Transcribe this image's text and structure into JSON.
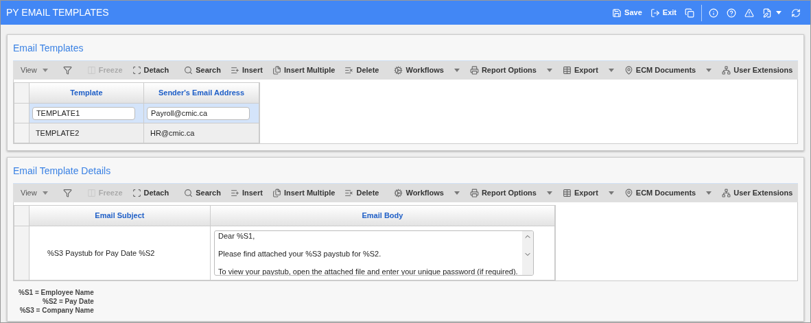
{
  "header": {
    "title": "PY EMAIL TEMPLATES",
    "actions": [
      {
        "kind": "save",
        "label": "Save"
      },
      {
        "kind": "exit",
        "label": "Exit"
      },
      {
        "kind": "copy"
      },
      {
        "kind": "info",
        "separator": true
      },
      {
        "kind": "help"
      },
      {
        "kind": "warning"
      },
      {
        "kind": "edit",
        "menu": true
      },
      {
        "kind": "refresh"
      }
    ]
  },
  "panels": [
    {
      "title": "Email Templates",
      "toolbar": [
        {
          "kind": "view",
          "label": "View",
          "menu": true,
          "disabled": false
        },
        {
          "kind": "filter",
          "disabled": false
        },
        {
          "kind": "freeze",
          "label": "Freeze",
          "disabled": true
        },
        {
          "kind": "detach",
          "label": "Detach",
          "disabled": false
        },
        {
          "kind": "search",
          "label": "Search",
          "disabled": false
        },
        {
          "kind": "insert",
          "label": "Insert",
          "disabled": false
        },
        {
          "kind": "insert-multiple",
          "label": "Insert Multiple",
          "disabled": false
        },
        {
          "kind": "delete",
          "label": "Delete",
          "disabled": false
        },
        {
          "kind": "workflows",
          "label": "Workflows",
          "menu": true,
          "disabled": false
        },
        {
          "kind": "report",
          "label": "Report Options",
          "menu": true,
          "disabled": false
        },
        {
          "kind": "export",
          "label": "Export",
          "menu": true,
          "disabled": false
        },
        {
          "kind": "ecm",
          "label": "ECM Documents",
          "menu": true,
          "disabled": false
        },
        {
          "kind": "extensions",
          "label": "User Extensions",
          "disabled": false
        }
      ],
      "table": {
        "kind": "simple",
        "columns": [
          "Template",
          "Sender's Email Address"
        ],
        "rows": [
          {
            "selected": true,
            "cells": [
              "TEMPLATE1",
              "Payroll@cmic.ca"
            ]
          },
          {
            "selected": false,
            "cells": [
              "TEMPLATE2",
              "HR@cmic.ca"
            ]
          }
        ]
      }
    },
    {
      "title": "Email Template Details",
      "toolbar": [
        {
          "kind": "view",
          "label": "View",
          "menu": true,
          "disabled": false
        },
        {
          "kind": "filter",
          "disabled": false
        },
        {
          "kind": "freeze",
          "label": "Freeze",
          "disabled": true
        },
        {
          "kind": "detach",
          "label": "Detach",
          "disabled": false
        },
        {
          "kind": "search",
          "label": "Search",
          "disabled": false
        },
        {
          "kind": "insert",
          "label": "Insert",
          "disabled": false
        },
        {
          "kind": "insert-multiple",
          "label": "Insert Multiple",
          "disabled": false
        },
        {
          "kind": "delete",
          "label": "Delete",
          "disabled": false
        },
        {
          "kind": "workflows",
          "label": "Workflows",
          "menu": true,
          "disabled": false
        },
        {
          "kind": "report",
          "label": "Report Options",
          "menu": true,
          "disabled": false
        },
        {
          "kind": "export",
          "label": "Export",
          "menu": true,
          "disabled": false
        },
        {
          "kind": "ecm",
          "label": "ECM Documents",
          "menu": true,
          "disabled": false
        },
        {
          "kind": "extensions",
          "label": "User Extensions",
          "disabled": false
        }
      ],
      "table": {
        "kind": "body",
        "columns": [
          "Email Subject",
          "Email Body"
        ],
        "rows": [
          {
            "selected": false,
            "cells": [
              "%S3 Paystub for Pay Date %S2"
            ],
            "body": [
              "Dear %S1,",
              "Please find attached your %S3 paystub for %S2.",
              "To view your paystub, open the attached file and enter your unique password (if required)."
            ]
          }
        ]
      },
      "legend": [
        "%S1 = Employee Name",
        "%S2 = Pay Date",
        "%S3 = Company Name"
      ]
    }
  ]
}
